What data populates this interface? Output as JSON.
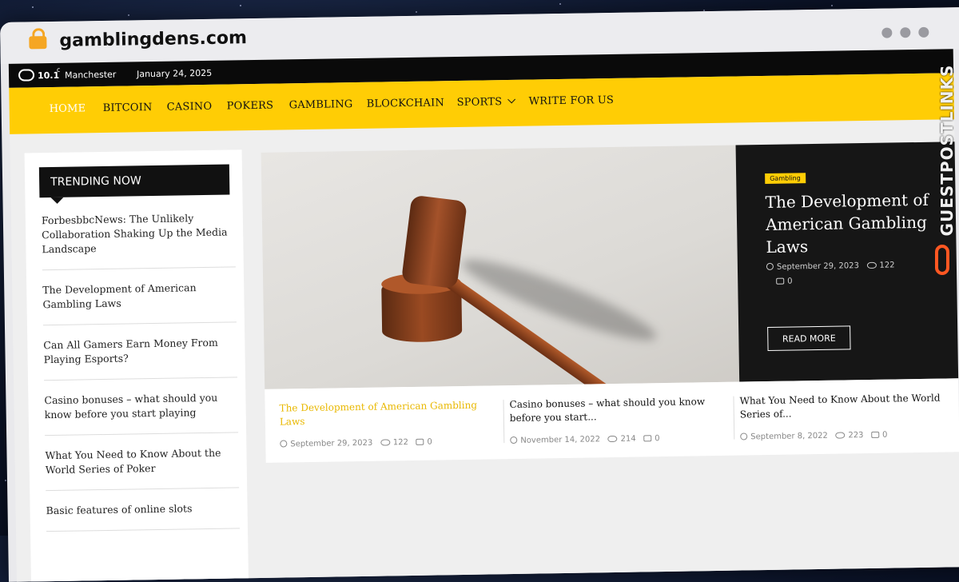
{
  "browser": {
    "url": "gamblingdens.com"
  },
  "topbar": {
    "temperature": "10.1",
    "unit": "c",
    "city": "Manchester",
    "date": "January 24, 2025"
  },
  "nav": {
    "items": [
      {
        "label": "HOME",
        "active": true
      },
      {
        "label": "BITCOIN"
      },
      {
        "label": "CASINO"
      },
      {
        "label": "POKERS"
      },
      {
        "label": "GAMBLING"
      },
      {
        "label": "BLOCKCHAIN"
      },
      {
        "label": "SPORTS",
        "has_dropdown": true
      },
      {
        "label": "WRITE FOR US"
      }
    ]
  },
  "sidebar": {
    "heading": "TRENDING NOW",
    "items": [
      "ForbesbbcNews: The Unlikely Collaboration Shaking Up the Media Landscape",
      "The Development of American Gambling Laws",
      "Can All Gamers Earn Money From Playing Esports?",
      "Casino bonuses – what should you know before you start playing",
      "What You Need to Know About the World Series of Poker",
      "Basic features of online slots"
    ]
  },
  "feature": {
    "tag": "Gambling",
    "title": "The Development of American Gambling Laws",
    "date": "September 29, 2023",
    "views": "122",
    "comments": "0",
    "read_more": "READ MORE"
  },
  "cards": [
    {
      "title": "The Development of American Gambling Laws",
      "date": "September 29, 2023",
      "views": "122",
      "comments": "0"
    },
    {
      "title": "Casino bonuses – what should you know before you start...",
      "date": "November 14, 2022",
      "views": "214",
      "comments": "0"
    },
    {
      "title": "What You Need to Know About the World Series of...",
      "date": "September 8, 2022",
      "views": "223",
      "comments": "0"
    }
  ],
  "brand": {
    "text": "GUESTPOSTLINKS",
    "accent": "#ff5722"
  },
  "colors": {
    "nav_bg": "#ffcd05",
    "topbar_bg": "#0a0a0a",
    "feature_bg": "#161616",
    "highlight": "#e9b800"
  }
}
